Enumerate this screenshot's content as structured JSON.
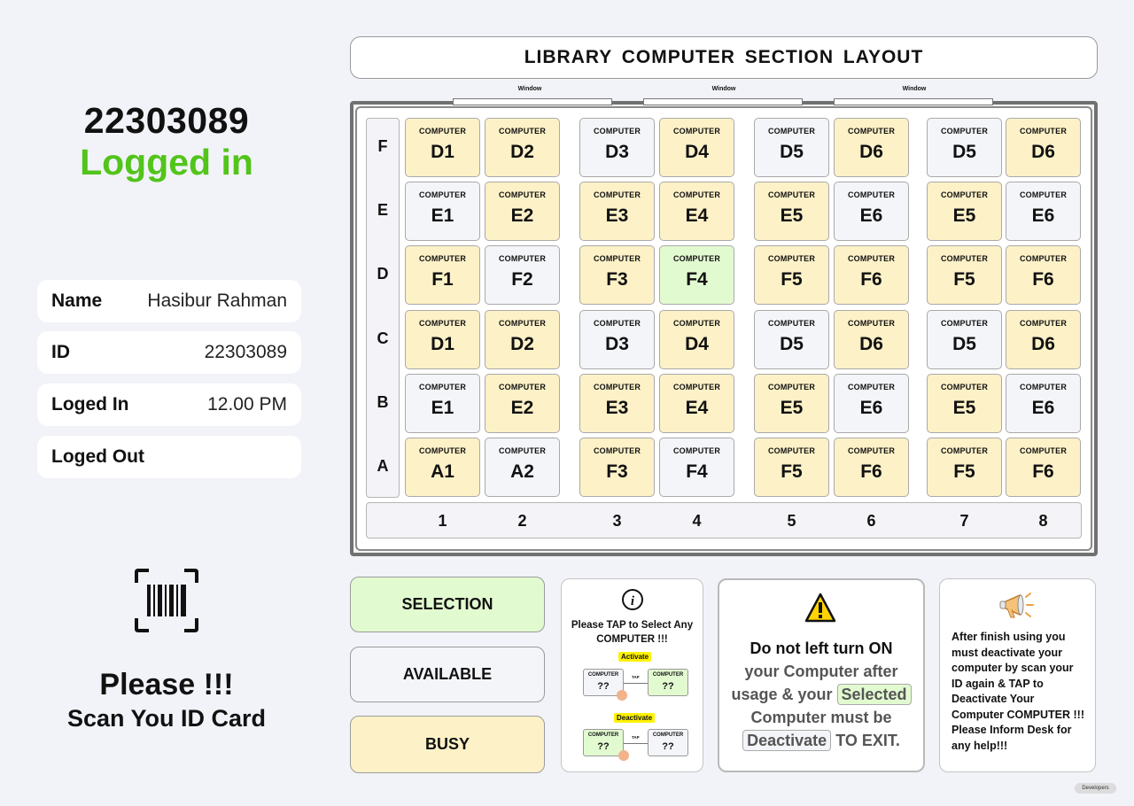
{
  "user": {
    "id_display": "22303089",
    "status": "Logged in",
    "status_color": "#52c41a",
    "details": [
      {
        "label": "Name",
        "value": "Hasibur Rahman"
      },
      {
        "label": "ID",
        "value": "22303089"
      },
      {
        "label": "Loged In",
        "value": "12.00 PM"
      },
      {
        "label": "Loged Out",
        "value": ""
      }
    ]
  },
  "scan": {
    "icon": "barcode-scan-icon",
    "title": "Please !!!",
    "subtitle": "Scan You ID Card"
  },
  "layout": {
    "title": "LIBRARY COMPUTER SECTION LAYOUT",
    "windows": [
      "Window",
      "Window",
      "Window"
    ],
    "row_labels": [
      "F",
      "E",
      "D",
      "C",
      "B",
      "A"
    ],
    "col_labels": [
      "1",
      "2",
      "3",
      "4",
      "5",
      "6",
      "7",
      "8"
    ],
    "seat_prefix": "COMPUTER",
    "grid": [
      [
        {
          "id": "D1",
          "status": "busy"
        },
        {
          "id": "D2",
          "status": "busy"
        },
        {
          "id": "D3",
          "status": "available"
        },
        {
          "id": "D4",
          "status": "busy"
        },
        {
          "id": "D5",
          "status": "available"
        },
        {
          "id": "D6",
          "status": "busy"
        },
        {
          "id": "D5",
          "status": "available"
        },
        {
          "id": "D6",
          "status": "busy"
        }
      ],
      [
        {
          "id": "E1",
          "status": "available"
        },
        {
          "id": "E2",
          "status": "busy"
        },
        {
          "id": "E3",
          "status": "busy"
        },
        {
          "id": "E4",
          "status": "busy"
        },
        {
          "id": "E5",
          "status": "busy"
        },
        {
          "id": "E6",
          "status": "available"
        },
        {
          "id": "E5",
          "status": "busy"
        },
        {
          "id": "E6",
          "status": "available"
        }
      ],
      [
        {
          "id": "F1",
          "status": "busy"
        },
        {
          "id": "F2",
          "status": "available"
        },
        {
          "id": "F3",
          "status": "busy"
        },
        {
          "id": "F4",
          "status": "selected"
        },
        {
          "id": "F5",
          "status": "busy"
        },
        {
          "id": "F6",
          "status": "busy"
        },
        {
          "id": "F5",
          "status": "busy"
        },
        {
          "id": "F6",
          "status": "busy"
        }
      ],
      [
        {
          "id": "D1",
          "status": "busy"
        },
        {
          "id": "D2",
          "status": "busy"
        },
        {
          "id": "D3",
          "status": "available"
        },
        {
          "id": "D4",
          "status": "busy"
        },
        {
          "id": "D5",
          "status": "available"
        },
        {
          "id": "D6",
          "status": "busy"
        },
        {
          "id": "D5",
          "status": "available"
        },
        {
          "id": "D6",
          "status": "busy"
        }
      ],
      [
        {
          "id": "E1",
          "status": "available"
        },
        {
          "id": "E2",
          "status": "busy"
        },
        {
          "id": "E3",
          "status": "busy"
        },
        {
          "id": "E4",
          "status": "busy"
        },
        {
          "id": "E5",
          "status": "busy"
        },
        {
          "id": "E6",
          "status": "available"
        },
        {
          "id": "E5",
          "status": "busy"
        },
        {
          "id": "E6",
          "status": "available"
        }
      ],
      [
        {
          "id": "A1",
          "status": "busy"
        },
        {
          "id": "A2",
          "status": "available"
        },
        {
          "id": "F3",
          "status": "busy"
        },
        {
          "id": "F4",
          "status": "available"
        },
        {
          "id": "F5",
          "status": "busy"
        },
        {
          "id": "F6",
          "status": "busy"
        },
        {
          "id": "F5",
          "status": "busy"
        },
        {
          "id": "F6",
          "status": "busy"
        }
      ]
    ]
  },
  "legend": {
    "selection": "SELECTION",
    "available": "AVAILABLE",
    "busy": "BUSY"
  },
  "colors": {
    "selected": "#e2fad0",
    "available": "#f4f5f9",
    "busy": "#fdf1c7"
  },
  "instructions": {
    "icon": "info-icon",
    "title": "Please TAP to Select Any COMPUTER !!!",
    "activate_label": "Activate",
    "deactivate_label": "Deactivate",
    "mini_prefix": "COMPUTER",
    "mini_id": "??",
    "tap_label": "TAP"
  },
  "warning": {
    "icon": "warning-icon",
    "line1": "Do not left turn ON",
    "line2": "your Computer after",
    "line3_pre": "usage & your",
    "line3_hl": "Selected",
    "line4": "Computer must be",
    "line5_hl": "Deactivate",
    "line5_post": "TO EXIT."
  },
  "help": {
    "icon": "megaphone-icon",
    "text": "After finish using you must deactivate your computer by scan your ID again & TAP to Deactivate Your Computer COMPUTER !!! Please Inform Desk for any help!!!"
  },
  "footer": {
    "badge": "Developers"
  }
}
